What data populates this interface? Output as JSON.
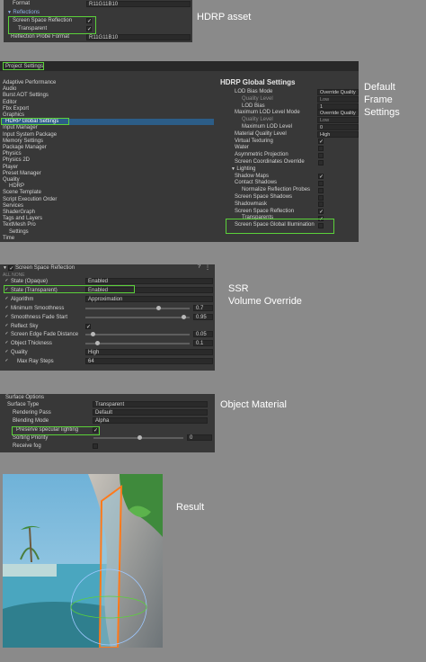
{
  "captions": {
    "hdrp_asset": "HDRP asset",
    "frame_settings": [
      "Default",
      "Frame",
      "Settings"
    ],
    "ssr": [
      "SSR",
      "Volume Override"
    ],
    "object_material": "Object Material",
    "result": "Result"
  },
  "panel1": {
    "rows": [
      {
        "label": "Format",
        "value": "R11G11B10"
      },
      {
        "label": "Reflections"
      },
      {
        "label": "Screen Space Reflection",
        "checked": "✓"
      },
      {
        "label": "Transparent",
        "checked": "✓"
      },
      {
        "label": "Reflection Probe Format",
        "value": "R11G11B10"
      }
    ]
  },
  "panel2": {
    "window_title": "Project Settings",
    "categories": [
      "Adaptive Performance",
      "Audio",
      "Burst AOT Settings",
      "Editor",
      "Fbx Export",
      "Graphics",
      "HDRP Global Settings",
      "Input Manager",
      "Input System Package",
      "Memory Settings",
      "Package Manager",
      "Physics",
      "Physics 2D",
      "Player",
      "Preset Manager",
      "Quality",
      "HDRP",
      "Scene Template",
      "Script Execution Order",
      "Services",
      "ShaderGraph",
      "Tags and Layers",
      "TextMesh Pro",
      "Settings",
      "Time"
    ],
    "title": "HDRP Global Settings",
    "settings": [
      {
        "label": "LOD Bias Mode",
        "value": "Override Quality"
      },
      {
        "label": "Quality Level",
        "value": "Low"
      },
      {
        "label": "LOD Bias",
        "value": "1"
      },
      {
        "label": "Maximum LOD Level Mode",
        "value": "Override Quality"
      },
      {
        "label": "Quality Level",
        "value": "Low"
      },
      {
        "label": "Maximum LOD Level",
        "value": "0"
      },
      {
        "label": "Material Quality Level",
        "value": "High"
      },
      {
        "label": "Virtual Texturing",
        "checked": "✓"
      },
      {
        "label": "Water"
      },
      {
        "label": "Asymmetric Projection"
      },
      {
        "label": "Screen Coordinates Override"
      },
      {
        "label": "Lighting"
      },
      {
        "label": "Shadow Maps",
        "checked": "✓"
      },
      {
        "label": "Contact Shadows"
      },
      {
        "label": "Normalize Reflection Probes"
      },
      {
        "label": "Screen Space Shadows"
      },
      {
        "label": "Shadowmask"
      },
      {
        "label": "Screen Space Reflection",
        "checked": "✓"
      },
      {
        "label": "Transparents",
        "checked": "✓"
      },
      {
        "label": "Screen Space Global Illumination"
      }
    ]
  },
  "panel3": {
    "title": "Screen Space Reflection",
    "subheader": "ALL  NONE",
    "rows": [
      {
        "label": "State (Opaque)",
        "value": "Enabled"
      },
      {
        "label": "State (Transparent)",
        "value": "Enabled"
      },
      {
        "label": "Algorithm",
        "value": "Approximation"
      },
      {
        "label": "Minimum Smoothness",
        "value": "0.7",
        "level": 0.7
      },
      {
        "label": "Smoothness Fade Start",
        "value": "0.95",
        "level": 0.95
      },
      {
        "label": "Reflect Sky",
        "checked": "✓"
      },
      {
        "label": "Screen Edge Fade Distance",
        "value": "0.05",
        "level": 0.05
      },
      {
        "label": "Object Thickness",
        "value": "0.1",
        "level": 0.1
      },
      {
        "label": "Quality",
        "value": "High"
      },
      {
        "label": "Max Ray Steps",
        "value": "64"
      }
    ]
  },
  "panel4": {
    "title": "Surface Options",
    "rows": [
      {
        "label": "Surface Type",
        "value": "Transparent"
      },
      {
        "label": "Rendering Pass",
        "value": "Default"
      },
      {
        "label": "Blending Mode",
        "value": "Alpha"
      },
      {
        "label": "Preserve specular lighting",
        "checked": "✓"
      },
      {
        "label": "Sorting Priority",
        "value": "0",
        "level": 0.5
      },
      {
        "label": "Receive fog"
      }
    ]
  },
  "colors": {
    "highlight": "#5bd13a",
    "selection": "#2c5d87",
    "panel": "#383838",
    "page": "#8a8a8a"
  }
}
